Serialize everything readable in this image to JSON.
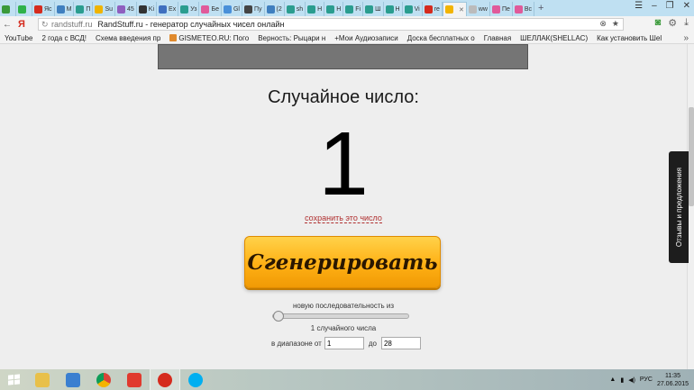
{
  "browser": {
    "tabs": [
      {
        "label": "",
        "color": "#3a9a3a"
      },
      {
        "label": "",
        "color": "#2fb24a"
      },
      {
        "label": "Яс",
        "color": "#d52b1e"
      },
      {
        "label": "М",
        "color": "#3f7fbf"
      },
      {
        "label": "П",
        "color": "#2a9d8f"
      },
      {
        "label": "Su",
        "color": "#f0b400"
      },
      {
        "label": "45",
        "color": "#8f5fbf"
      },
      {
        "label": "Ki",
        "color": "#333333"
      },
      {
        "label": "Ex",
        "color": "#3f6fbf"
      },
      {
        "label": "Уз",
        "color": "#2a9d8f"
      },
      {
        "label": "Бе",
        "color": "#e05a9a"
      },
      {
        "label": "Gl",
        "color": "#4a90d9"
      },
      {
        "label": "Пу",
        "color": "#444444"
      },
      {
        "label": "(2",
        "color": "#3f7fbf"
      },
      {
        "label": "sh",
        "color": "#2a9d8f"
      },
      {
        "label": "Н",
        "color": "#2a9d8f"
      },
      {
        "label": "Н",
        "color": "#2a9d8f"
      },
      {
        "label": "Fi",
        "color": "#2a9d8f"
      },
      {
        "label": "Ш",
        "color": "#2a9d8f"
      },
      {
        "label": "Н",
        "color": "#2a9d8f"
      },
      {
        "label": "Vi",
        "color": "#2a9d8f"
      },
      {
        "label": "re",
        "color": "#d52b1e"
      },
      {
        "label": "",
        "color": "#f2b400",
        "active": true
      },
      {
        "label": "ww",
        "color": "#bbbbbb"
      },
      {
        "label": "Пе",
        "color": "#e05a9a"
      },
      {
        "label": "Вс",
        "color": "#e05a9a"
      }
    ],
    "new_tab": "+",
    "address": {
      "host": "randstuff.ru",
      "title": "RandStuff.ru - генератор случайных чисел онлайн"
    },
    "bookmarks": [
      "YouTube",
      "2 года с ВСД!",
      "Схема введения пр",
      "GISMETEO.RU: Пого",
      "Верность: Рыцари н",
      "+Мои Аудиозаписи",
      "Доска бесплатных о",
      "Главная",
      "ШЕЛЛАК(SHELLAC)",
      "Как установить Шеl"
    ],
    "bookmarks_more": "»"
  },
  "page": {
    "heading": "Случайное число:",
    "number": "1",
    "save_link": "сохранить это число",
    "generate_button": "Сгенерировать",
    "sequence_label": "новую последовательность из",
    "slider_value": 1,
    "count_text": "1 случайного числа",
    "range_from_label": "в диапазоне от",
    "range_from_value": "1",
    "range_to_label": "до",
    "range_to_value": "28",
    "feedback_tab": "Отзывы и предложения"
  },
  "taskbar": {
    "lang": "РУС",
    "time": "11:35",
    "date": "27.06.2015"
  }
}
